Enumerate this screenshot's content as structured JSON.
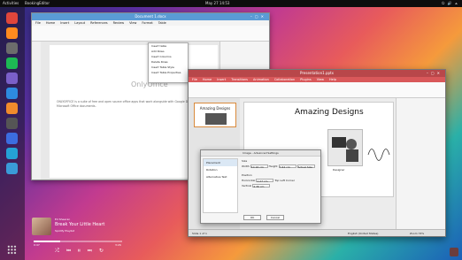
{
  "topbar": {
    "activities": "Activities",
    "app_name": "BookingEditor",
    "clock": "May 27 14:53",
    "tray": "⏻ 🔊 ⏶"
  },
  "dock": {
    "icons": [
      {
        "name": "chrome-icon",
        "color": "#e0463b"
      },
      {
        "name": "firefox-icon",
        "color": "#ff8a1f"
      },
      {
        "name": "files-icon",
        "color": "#6c6c6c"
      },
      {
        "name": "spotify-icon",
        "color": "#1db954"
      },
      {
        "name": "settings-icon",
        "color": "#7a5fc9"
      },
      {
        "name": "bookmark-icon",
        "color": "#2d8ae0"
      },
      {
        "name": "software-icon",
        "color": "#f08b2c"
      },
      {
        "name": "trash-icon",
        "color": "#555555"
      },
      {
        "name": "layers-icon",
        "color": "#3c6de0"
      },
      {
        "name": "music-icon",
        "color": "#25a2d6"
      },
      {
        "name": "globe-icon",
        "color": "#3a9bd8"
      }
    ]
  },
  "writer": {
    "title": "Document 1.docx",
    "menu": [
      "File",
      "Home",
      "Insert",
      "Layout",
      "References",
      "Review",
      "View",
      "Format",
      "Table"
    ],
    "doc_heading": "OnlyOffice",
    "doc_text": "ONLYOFFICE is a suite of free and open source office apps that work alongside with Google Drive and Microsoft Office documents.",
    "dropdown": [
      "Insert table",
      "Add Rows",
      "Insert Columns",
      "Delete Rows",
      "Insert Table Style",
      "Insert Table Properties"
    ]
  },
  "impress": {
    "title": "Presentation1.pptx",
    "menu": [
      "File",
      "Home",
      "Insert",
      "Transitions",
      "Animation",
      "Collaboration",
      "Plugins",
      "View",
      "Help"
    ],
    "slide_title": "Amazing Designs",
    "thumb_title": "Amazing Designs",
    "caption": "Designer",
    "status_left": "Slide 1 of 1",
    "status_right": "English (United States)",
    "zoom": "Zoom 74%"
  },
  "dialog": {
    "title": "Image - Advanced Settings",
    "nav": [
      "Placement",
      "Rotation",
      "Alternative Text"
    ],
    "size_label": "Size",
    "width_label": "Width",
    "height_label": "Height",
    "width_value": "10.16 cm",
    "height_value": "7.62 cm",
    "actual_size": "Actual Size",
    "position_label": "Position",
    "horizontal_label": "Horizontal",
    "vertical_label": "Vertical",
    "h_value": "1.27 cm",
    "v_value": "4.36 cm",
    "from_label": "Top Left Corner",
    "ok": "OK",
    "cancel": "Cancel"
  },
  "player": {
    "artist": "Ed Sheeran",
    "track": "Break Your Little Heart",
    "album": "Spotify Playlist",
    "elapsed": "0:47",
    "duration": "3:26",
    "progress": 0.3
  }
}
